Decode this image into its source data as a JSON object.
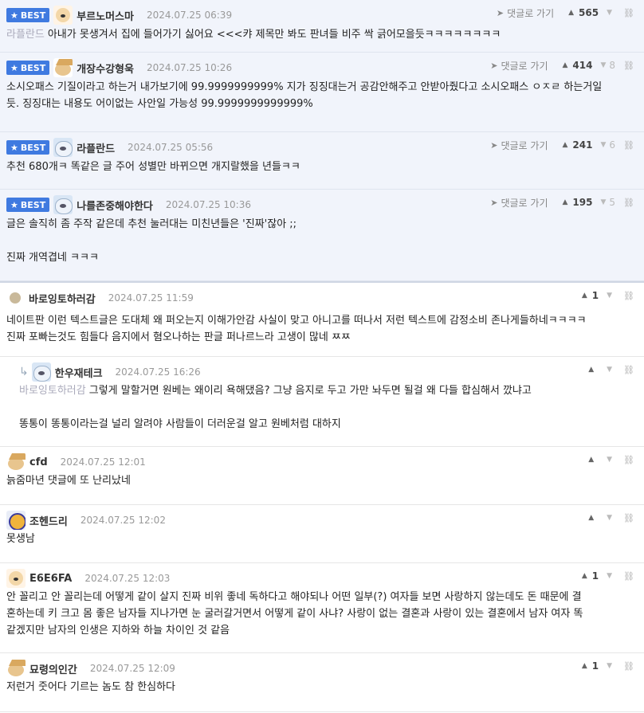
{
  "comments": [
    {
      "best": true,
      "avatar": "dog",
      "nick": "부르노머스마",
      "date": "2024.07.25 06:39",
      "goto": "댓글로 가기",
      "up": "565",
      "down": "",
      "mention": "라플란드",
      "lines": [
        "아내가 못생겨서 집에 들어가기 싫어요 <<<캬 제목만 봐도 판녀들 비주 싹 긁어모을듯ㅋㅋㅋㅋㅋㅋㅋㅋ"
      ]
    },
    {
      "best": true,
      "avatar": "cat",
      "nick": "개장수강형욱",
      "date": "2024.07.25 10:26",
      "goto": "댓글로 가기",
      "up": "414",
      "down": "8",
      "mention": "",
      "lines": [
        "소시오패스 기질이라고 하는거 내가보기에 99.9999999999% 지가 징징대는거 공감안해주고 안받아줬다고 소시오패스 ㅇㅈㄹ 하는거일",
        "듯. 징징대는 내용도 어이없는 사안일 가능성 99.9999999999999%"
      ]
    },
    {
      "best": true,
      "avatar": "bear",
      "nick": "라플란드",
      "date": "2024.07.25 05:56",
      "goto": "댓글로 가기",
      "up": "241",
      "down": "6",
      "mention": "",
      "lines": [
        "추천 680개ㅋ 똑같은 글 주어 성별만 바뀌으면 개지랄했을 년들ㅋㅋ"
      ]
    },
    {
      "best": true,
      "avatar": "bear",
      "nick": "나를존중해야한다",
      "date": "2024.07.25 10:36",
      "goto": "댓글로 가기",
      "up": "195",
      "down": "5",
      "mention": "",
      "lines": [
        "글은 솔직히 좀 주작 같은데 추천 눌러대는 미친년들은 '진짜'잖아 ;;",
        "",
        "진짜 개역겹네 ㅋㅋㅋ"
      ]
    },
    {
      "best": false,
      "avatar": "dot",
      "nick": "바로잉토하러감",
      "date": "2024.07.25 11:59",
      "up": "1",
      "down": "",
      "mention": "",
      "lines": [
        "네이트판 이런 텍스트글은 도대체 왜 퍼오는지 이해가안감 사실이 맞고 아니고를 떠나서 저런 텍스트에 감정소비 존나게들하네ㅋㅋㅋㅋ",
        "진짜 포빠는것도 힘들다 음지에서 혐오나하는 판글 퍼나르느라 고생이 많네 ㅉㅉ"
      ]
    },
    {
      "best": false,
      "reply": true,
      "avatar": "bear",
      "nick": "한우재테크",
      "date": "2024.07.25 16:26",
      "up": "",
      "down": "",
      "mention": "바로잉토하러감",
      "lines": [
        "그렇게 말할거면 원베는 왜이리 욕해댔음? 그냥 음지로 두고 가만 놔두면 될걸 왜 다들 합심해서 깠냐고",
        "",
        "똥통이 똥통이라는걸 널리 알려야 사람들이 더러운걸 알고 원베처럼 대하지"
      ]
    },
    {
      "best": false,
      "avatar": "cat",
      "nick": "cfd",
      "date": "2024.07.25 12:01",
      "up": "",
      "down": "",
      "mention": "",
      "lines": [
        "늙줌마년 댓글에 또 난리났네"
      ]
    },
    {
      "best": false,
      "avatar": "tiger",
      "nick": "조헨드리",
      "date": "2024.07.25 12:02",
      "up": "",
      "down": "",
      "mention": "",
      "lines": [
        "못생남"
      ]
    },
    {
      "best": false,
      "avatar": "dog",
      "nick": "E6E6FA",
      "date": "2024.07.25 12:03",
      "up": "1",
      "down": "",
      "mention": "",
      "lines": [
        "안 꼴리고 안 꼴리는데 어떻게 같이 살지 진짜 비위 좋네 독하다고 해야되나 어떤 일부(?) 여자들 보면 사랑하지 않는데도 돈 때문에 결",
        "혼하는데 키 크고 몸 좋은 남자들 지나가면 눈 굴러갈거면서 어떻게 같이 사냐? 사랑이 없는 결혼과 사랑이 있는 결혼에서 남자 여자 똑",
        "같겠지만 남자의 인생은 지하와 하늘 차이인 것 같음"
      ]
    },
    {
      "best": false,
      "avatar": "cat",
      "nick": "묘령의인간",
      "date": "2024.07.25 12:09",
      "up": "1",
      "down": "",
      "mention": "",
      "lines": [
        "저런거 줏어다 기르는 놈도 참 한심하다"
      ]
    }
  ],
  "best_label": "BEST",
  "icons": {
    "star": "star-icon",
    "thumb_up": "thumb-up-icon",
    "thumb_down": "thumb-down-icon",
    "link": "link-icon",
    "arrow": "goto-arrow-icon",
    "reply": "reply-arrow-icon"
  }
}
